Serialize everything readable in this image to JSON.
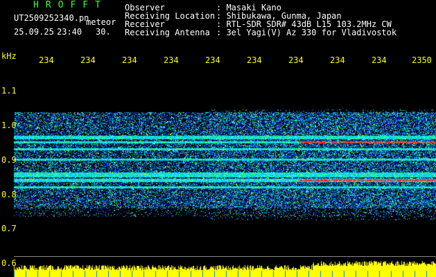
{
  "header": {
    "title": "HROFFT",
    "filename": "UT2509252340.pn",
    "mode": "meteor",
    "date": "25.09.25",
    "time": "23:40",
    "interval": "30."
  },
  "info": {
    "labels": [
      "Observer",
      "Receiving Location",
      "Receiver",
      "Receiving Antenna"
    ],
    "values": [
      ": Masaki Kano",
      ": Shibukawa, Gunma, Japan",
      ": RTL-SDR SDR# 43dB L15 103.2MHz CW",
      ": 3el Yagi(V) Az 330 for Vladivostok"
    ]
  },
  "axes": {
    "y_unit": "kHz",
    "y_ticks": [
      "1.1",
      "1.0",
      "0.9",
      "0.8",
      "0.7",
      "0.6"
    ],
    "x_ticks": [
      "234",
      "234",
      "234",
      "234",
      "234",
      "234",
      "234",
      "234",
      "234",
      "2350"
    ]
  },
  "colors": {
    "background": "#000000",
    "text_green": "#33ff33",
    "text_white": "#ffffff",
    "text_yellow": "#ffff00",
    "signal_low": "#0a1a8a",
    "signal_mid": "#00c8ff",
    "signal_high": "#ff2020"
  }
}
